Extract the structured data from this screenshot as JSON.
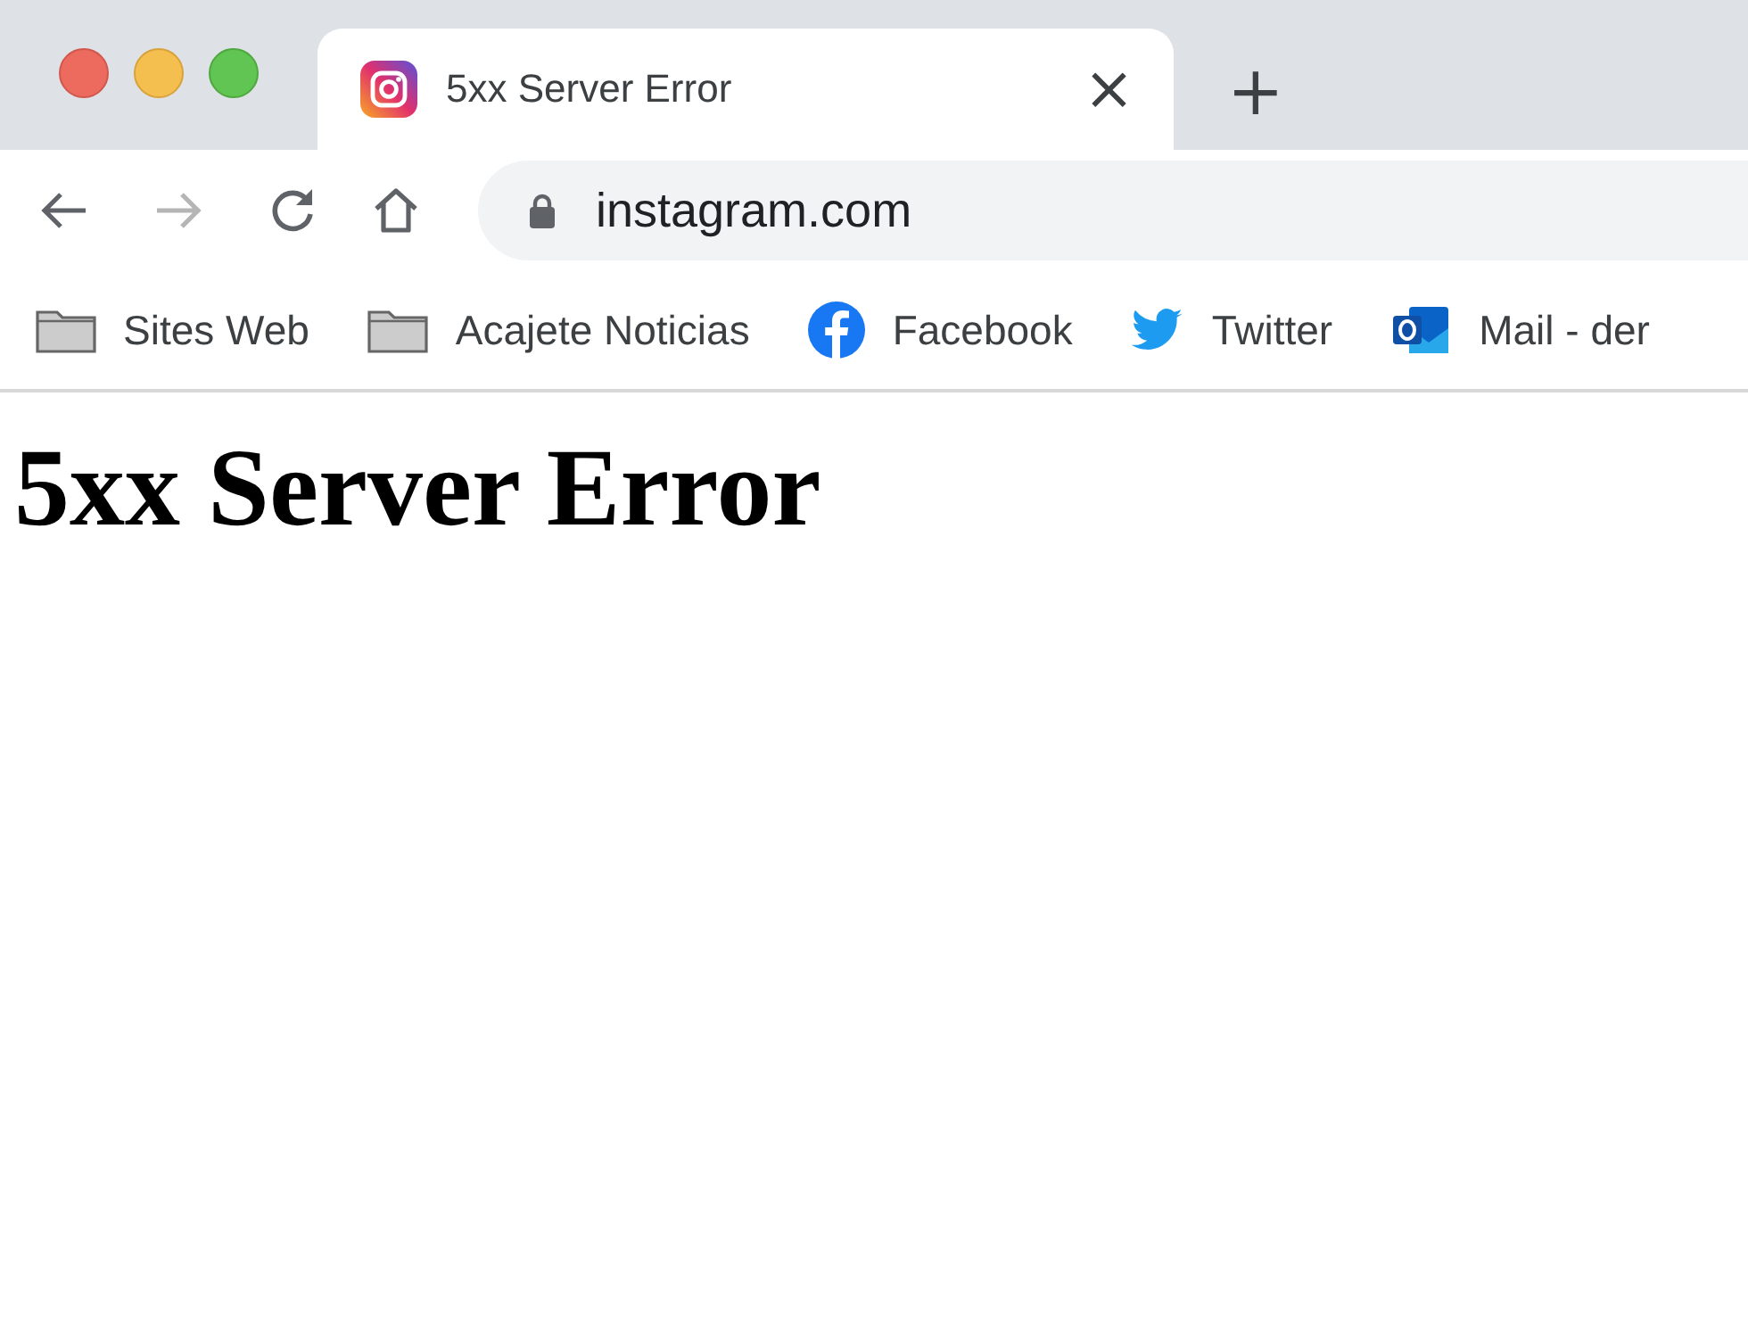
{
  "tabs": [
    {
      "title": "5xx Server Error",
      "selected": true,
      "close": "×"
    }
  ],
  "new_tab": "+",
  "nav": {
    "back_disabled": false,
    "forward_disabled": true
  },
  "address_bar": {
    "value": "instagram.com",
    "secure": true
  },
  "bookmarks": [
    {
      "kind": "folder",
      "label": "Sites Web"
    },
    {
      "kind": "folder",
      "label": "Acajete Noticias"
    },
    {
      "kind": "facebook",
      "label": "Facebook"
    },
    {
      "kind": "twitter",
      "label": "Twitter"
    },
    {
      "kind": "mail",
      "label": "Mail - der"
    }
  ],
  "page": {
    "heading": "5xx Server Error"
  }
}
